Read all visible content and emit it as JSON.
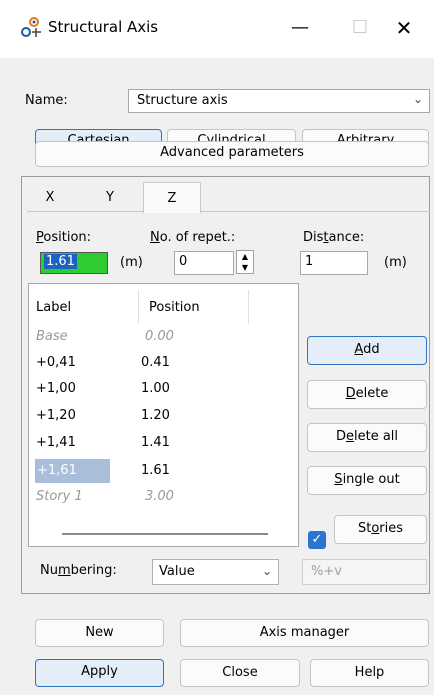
{
  "window": {
    "title": "Structural Axis",
    "minimize_glyph": "—",
    "maximize_glyph": "☐",
    "close_glyph": "✕",
    "icon": "structural-axis-icon"
  },
  "name_row": {
    "label": "Name:",
    "value": "Structure axis"
  },
  "axis_types": {
    "cartesian": {
      "pre": "",
      "u": "C",
      "post": "artesian"
    },
    "cylindrical": {
      "pre": "Cyli",
      "u": "n",
      "post": "drical"
    },
    "arbitrary": {
      "pre": "",
      "u": "A",
      "post": "rbitrary"
    }
  },
  "advanced_label": "Advanced parameters",
  "tabs": {
    "x": "X",
    "y": "Y",
    "z": "Z"
  },
  "position": {
    "pre": "",
    "u": "P",
    "post": "osition:",
    "value": "1.61",
    "unit": "(m)"
  },
  "repetitions": {
    "pre": "",
    "u": "N",
    "post": "o. of repet.:",
    "value": "0"
  },
  "distance": {
    "pre": "Dis",
    "u": "t",
    "post": "ance:",
    "value": "1",
    "unit": "(m)"
  },
  "list": {
    "col_label": "Label",
    "col_position": "Position",
    "rows": [
      {
        "label": "Base",
        "position": "0.00"
      },
      {
        "label": "+0,41",
        "position": "0.41"
      },
      {
        "label": "+1,00",
        "position": "1.00"
      },
      {
        "label": "+1,20",
        "position": "1.20"
      },
      {
        "label": "+1,41",
        "position": "1.41"
      },
      {
        "label": "+1,61",
        "position": "1.61"
      },
      {
        "label": "Story 1",
        "position": "3.00"
      }
    ]
  },
  "side_buttons": {
    "add": {
      "pre": "",
      "u": "A",
      "post": "dd"
    },
    "delete": {
      "pre": "",
      "u": "D",
      "post": "elete"
    },
    "delete_all": {
      "pre": "D",
      "u": "e",
      "post": "lete all"
    },
    "single_out": {
      "pre": "",
      "u": "S",
      "post": "ingle out"
    }
  },
  "stories": {
    "pre": "St",
    "u": "o",
    "post": "ries",
    "checked": true
  },
  "numbering": {
    "pre": "Nu",
    "u": "m",
    "post": "bering:",
    "value": "Value",
    "format": "%+v"
  },
  "bottom": {
    "new": "New",
    "axis_manager": "Axis manager",
    "apply": "Apply",
    "close": "Close",
    "help": "Help"
  },
  "colors": {
    "accent": "#2f73c2",
    "position_field": "#2ecc2e",
    "selection": "#a9bedb"
  }
}
